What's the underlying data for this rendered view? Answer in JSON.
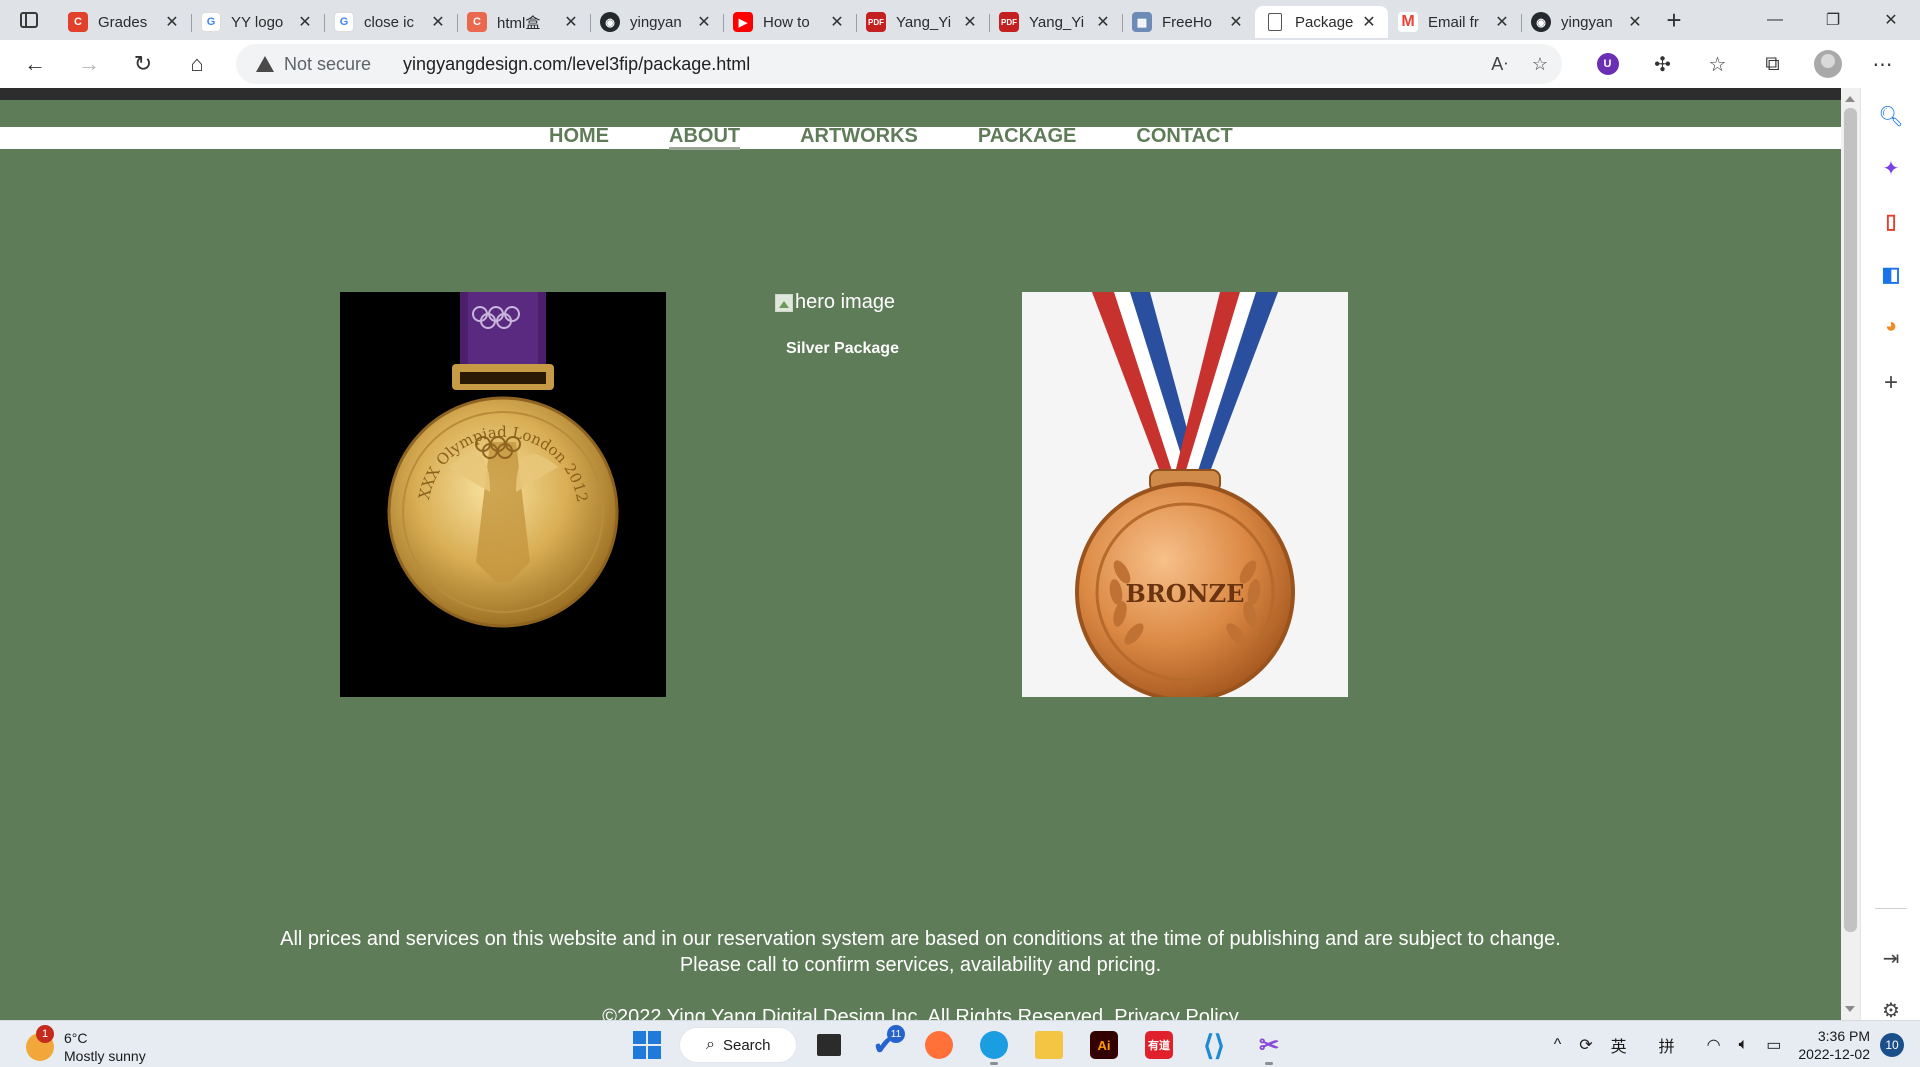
{
  "browser": {
    "tabs": [
      {
        "label": "Grades",
        "icon": "canvas-icon",
        "color": "#e2402a"
      },
      {
        "label": "YY logo",
        "icon": "google-icon",
        "color": "#4285f4"
      },
      {
        "label": "close ic",
        "icon": "google-icon",
        "color": "#4285f4"
      },
      {
        "label": "html盒",
        "icon": "c-site-icon",
        "color": "#e9684e"
      },
      {
        "label": "yingyan",
        "icon": "github-icon",
        "color": "#24292e"
      },
      {
        "label": "How to",
        "icon": "youtube-icon",
        "color": "#ff0000"
      },
      {
        "label": "Yang_Yi",
        "icon": "pdf-icon",
        "color": "#c3201f"
      },
      {
        "label": "Yang_Yi",
        "icon": "pdf-icon",
        "color": "#c3201f"
      },
      {
        "label": "FreeHo",
        "icon": "freehost-icon",
        "color": "#6e8bb8"
      },
      {
        "label": "Package",
        "icon": "page-icon",
        "color": "#666666"
      },
      {
        "label": "Email fr",
        "icon": "gmail-icon",
        "color": "#ea4335"
      },
      {
        "label": "yingyan",
        "icon": "github-icon",
        "color": "#24292e"
      }
    ],
    "security_label": "Not secure",
    "url": "yingyangdesign.com/level3fip/package.html",
    "extension_label": "U"
  },
  "site": {
    "nav": [
      {
        "label": "HOME"
      },
      {
        "label": "ABOUT"
      },
      {
        "label": "ARTWORKS"
      },
      {
        "label": "PACKAGE"
      },
      {
        "label": "CONTACT"
      }
    ],
    "hero_alt": "hero image",
    "package_name": "Silver Package",
    "gold_medal_text": "XXX Olympiad London 2012",
    "bronze_medal_text": "BRONZE",
    "disclaimer_line1": "All prices and services on this website and in our reservation system are based on conditions at the time of publishing and are subject to change.",
    "disclaimer_line2": "Please call to confirm services, availability and pricing.",
    "copyright": "©2022 Ying Yang Digital Design Inc. All Rights Reserved. Privacy Policy",
    "bg_color": "#5f7c58"
  },
  "taskbar": {
    "weather_badge": "1",
    "temperature": "6°C",
    "weather_desc": "Mostly sunny",
    "search_label": "Search",
    "todo_badge": "11",
    "ime_lang": "英",
    "ime_mode": "拼",
    "time": "3:36 PM",
    "date": "2022-12-02",
    "notifications": "10"
  }
}
